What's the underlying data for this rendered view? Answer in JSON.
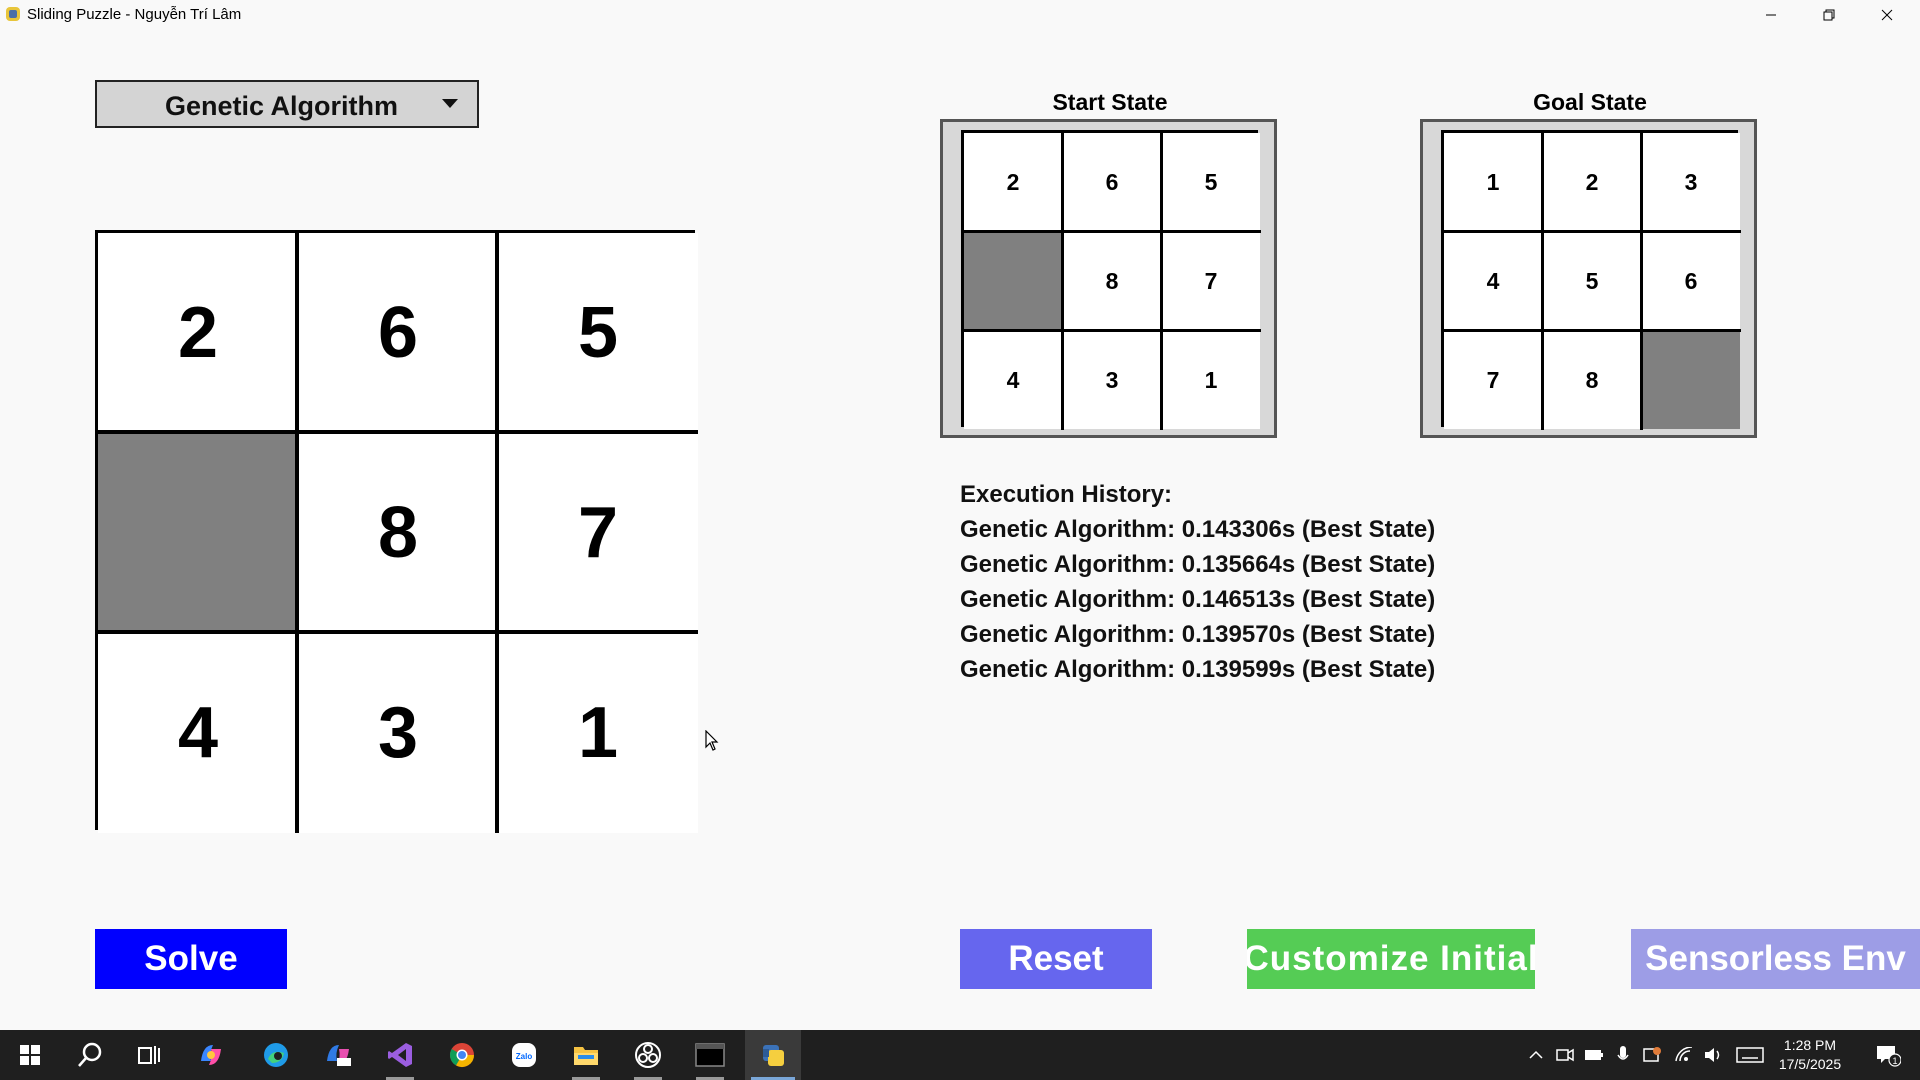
{
  "window": {
    "title": "Sliding Puzzle - Nguyễn Trí Lâm"
  },
  "algorithm_select": {
    "selected": "Genetic Algorithm"
  },
  "main_board": {
    "tiles": [
      "2",
      "6",
      "5",
      "",
      "8",
      "7",
      "4",
      "3",
      "1"
    ]
  },
  "start_state": {
    "title": "Start State",
    "tiles": [
      "2",
      "6",
      "5",
      "",
      "8",
      "7",
      "4",
      "3",
      "1"
    ]
  },
  "goal_state": {
    "title": "Goal State",
    "tiles": [
      "1",
      "2",
      "3",
      "4",
      "5",
      "6",
      "7",
      "8",
      ""
    ]
  },
  "history": {
    "title": "Execution History:",
    "entries": [
      "Genetic Algorithm: 0.143306s (Best State)",
      "Genetic Algorithm: 0.135664s (Best State)",
      "Genetic Algorithm: 0.146513s (Best State)",
      "Genetic Algorithm: 0.139570s (Best State)",
      "Genetic Algorithm: 0.139599s (Best State)"
    ]
  },
  "buttons": {
    "solve": "Solve",
    "reset": "Reset",
    "customize": "Customize Initial",
    "sensorless": "Sensorless Env"
  },
  "colors": {
    "blank_tile": "#808080",
    "solve": "#0000ff",
    "reset": "#6666ee",
    "customize": "#55cc55",
    "sensorless": "#9d9de6"
  },
  "taskbar": {
    "apps": [
      "start-icon",
      "search-icon",
      "task-view-icon",
      "copilot-icon",
      "edge-icon",
      "microsoft365-icon",
      "visual-studio-icon",
      "chrome-icon",
      "zalo-icon",
      "file-explorer-icon",
      "obs-icon",
      "terminal-icon",
      "python-icon"
    ],
    "zalo_label": "Zalo",
    "time": "1:28 PM",
    "date": "17/5/2025",
    "notification_count": "1"
  }
}
